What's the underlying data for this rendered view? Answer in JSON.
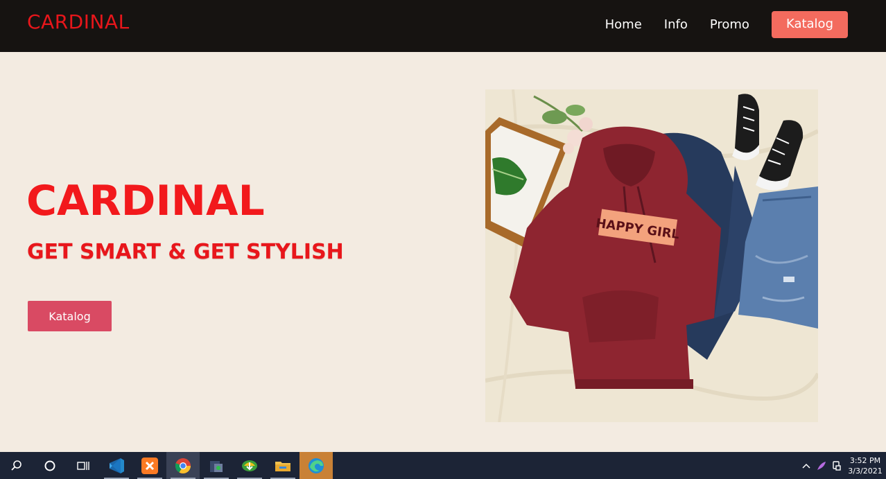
{
  "navbar": {
    "brand": "CARDINAL",
    "links": [
      "Home",
      "Info",
      "Promo"
    ],
    "cta": "Katalog"
  },
  "hero": {
    "title": "CARDINAL",
    "subtitle": "GET SMART & GET STYLISH",
    "button": "Katalog",
    "image_text": "HAPPY GIRL"
  },
  "taskbar": {
    "icons": [
      "search-icon",
      "cortana-icon",
      "task-view-icon",
      "vscode-icon",
      "xampp-icon",
      "chrome-icon",
      "vpn-icon",
      "idm-icon",
      "file-explorer-icon",
      "edge-icon"
    ],
    "time": "3:52 PM",
    "date": "3/3/2021"
  },
  "colors": {
    "brand_red": "#e8161b",
    "nav_bg": "#161311",
    "page_bg": "#f3ebe1",
    "nav_cta_bg": "#f36b5e",
    "hero_btn_bg": "#d94a63",
    "taskbar_bg": "#1c2436"
  }
}
